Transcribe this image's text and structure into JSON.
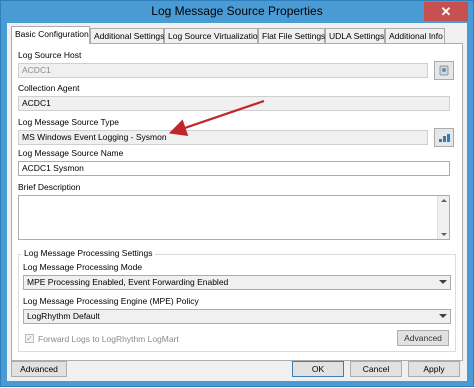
{
  "window": {
    "title": "Log Message Source Properties",
    "close_glyph": "✕"
  },
  "tabs": [
    {
      "label": "Basic Configuration"
    },
    {
      "label": "Additional Settings"
    },
    {
      "label": "Log Source Virtualization"
    },
    {
      "label": "Flat File Settings"
    },
    {
      "label": "UDLA Settings"
    },
    {
      "label": "Additional Info"
    }
  ],
  "form": {
    "log_source_host": {
      "label": "Log Source Host",
      "value": "ACDC1"
    },
    "collection_agent": {
      "label": "Collection Agent",
      "value": "ACDC1"
    },
    "source_type": {
      "label": "Log Message Source Type",
      "value": "MS Windows Event Logging - Sysmon"
    },
    "source_name": {
      "label": "Log Message Source Name",
      "value": "ACDC1 Sysmon"
    },
    "brief_description": {
      "label": "Brief Description",
      "value": ""
    },
    "processing": {
      "group_label": "Log Message Processing Settings",
      "mode_label": "Log Message Processing Mode",
      "mode_value": "MPE Processing Enabled, Event Forwarding Enabled",
      "policy_label": "Log Message Processing Engine (MPE) Policy",
      "policy_value": "LogRhythm Default",
      "forward_label": "Forward Logs to LogRhythm LogMart",
      "forward_checked": true,
      "advanced_label": "Advanced"
    }
  },
  "footer": {
    "advanced_label": "Advanced",
    "ok_label": "OK",
    "cancel_label": "Cancel",
    "apply_label": "Apply"
  },
  "annotation": {
    "arrow_color": "#c0262c"
  }
}
